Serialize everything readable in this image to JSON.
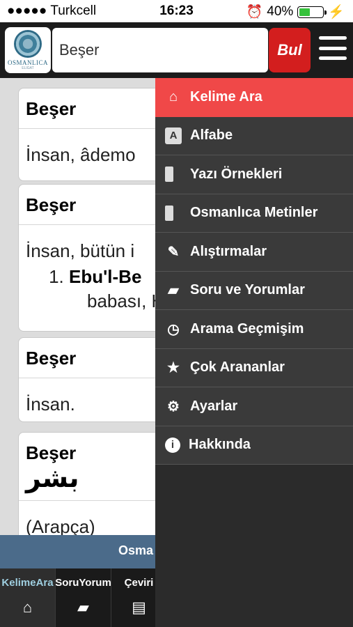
{
  "status_bar": {
    "carrier": "●●●●● Turkcell",
    "time": "16:23",
    "battery": "40%",
    "battery_level": 0.4
  },
  "header": {
    "logo_text": "OSMANLICA",
    "logo_sub": "ELIGAT",
    "search_value": "Beşer",
    "search_button": "Bul"
  },
  "results": [
    {
      "word": "Beşer",
      "definition": "İnsan, âdemo"
    },
    {
      "word": "Beşer",
      "definition": "İnsan, bütün i",
      "list_item_bold": "Ebu'l-Be",
      "list_item_rest": "babası, H"
    },
    {
      "word": "Beşer",
      "definition": "İnsan."
    },
    {
      "word": "Beşer",
      "arabic": "بشر",
      "definition": "(Arapça)"
    }
  ],
  "footer": {
    "banner": "Osma",
    "tabs": [
      {
        "label": "KelimeAra",
        "icon": "home-icon"
      },
      {
        "label": "SoruYorum",
        "icon": "chat-icon"
      },
      {
        "label": "Çeviri",
        "icon": "document-icon"
      }
    ]
  },
  "menu": {
    "items": [
      {
        "label": "Kelime Ara",
        "icon": "home-icon"
      },
      {
        "label": "Alfabe",
        "icon": "alphabet-icon"
      },
      {
        "label": "Yazı Örnekleri",
        "icon": "document-icon"
      },
      {
        "label": "Osmanlıca Metinler",
        "icon": "newspaper-icon"
      },
      {
        "label": "Alıştırmalar",
        "icon": "pencil-icon"
      },
      {
        "label": "Soru ve Yorumlar",
        "icon": "chat-icon"
      },
      {
        "label": "Arama Geçmişim",
        "icon": "clock-icon"
      },
      {
        "label": "Çok Arananlar",
        "icon": "star-icon"
      },
      {
        "label": "Ayarlar",
        "icon": "gear-icon"
      },
      {
        "label": "Hakkında",
        "icon": "info-icon"
      }
    ]
  },
  "colors": {
    "accent_red": "#d31e1e",
    "menu_active": "#f04848",
    "header_bg": "#1c1c1c",
    "banner_blue": "#4b6b8a"
  }
}
